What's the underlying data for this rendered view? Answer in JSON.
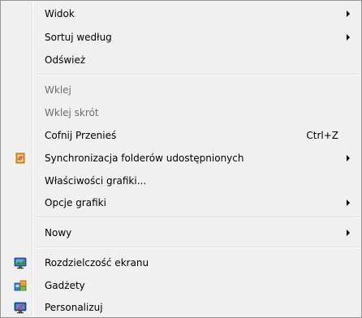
{
  "menu": {
    "items": [
      {
        "label": "Widok"
      },
      {
        "label": "Sortuj według"
      },
      {
        "label": "Odśwież"
      },
      {
        "label": "Wklej"
      },
      {
        "label": "Wklej skrót"
      },
      {
        "label": "Cofnij Przenieś",
        "shortcut": "Ctrl+Z"
      },
      {
        "label": "Synchronizacja folderów udostępnionych",
        "icon": "sync-icon"
      },
      {
        "label": "Właściwości grafiki..."
      },
      {
        "label": "Opcje grafiki"
      },
      {
        "label": "Nowy"
      },
      {
        "label": "Rozdzielczość ekranu",
        "icon": "monitor-icon"
      },
      {
        "label": "Gadżety",
        "icon": "gadgets-icon"
      },
      {
        "label": "Personalizuj",
        "icon": "personalize-icon"
      }
    ]
  },
  "colors": {
    "background": "#f0f0f0",
    "border": "#979797",
    "disabled_text": "#6d6d6d",
    "separator": "#e0e0e0"
  }
}
